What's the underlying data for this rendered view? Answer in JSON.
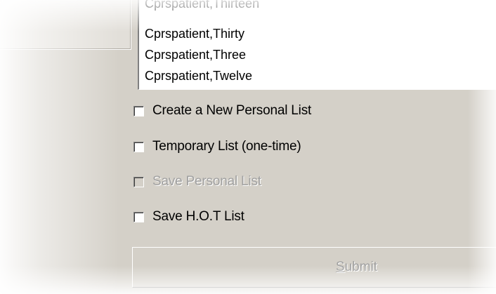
{
  "listbox": {
    "items": [
      "Cprspatient,Thirteen",
      "Cprspatient,Thirty",
      "Cprspatient,Three",
      "Cprspatient,Twelve"
    ]
  },
  "options": {
    "create_new": {
      "label": "Create a New Personal List",
      "checked": false,
      "enabled": true
    },
    "temporary": {
      "label": "Temporary List  (one-time)",
      "checked": false,
      "enabled": true
    },
    "save_personal": {
      "label": "Save Personal List",
      "checked": false,
      "enabled": false
    },
    "save_hot": {
      "label": "Save H.O.T List",
      "checked": false,
      "enabled": true
    }
  },
  "submit": {
    "mnemonic": "S",
    "rest": "ubmit",
    "enabled": false
  }
}
